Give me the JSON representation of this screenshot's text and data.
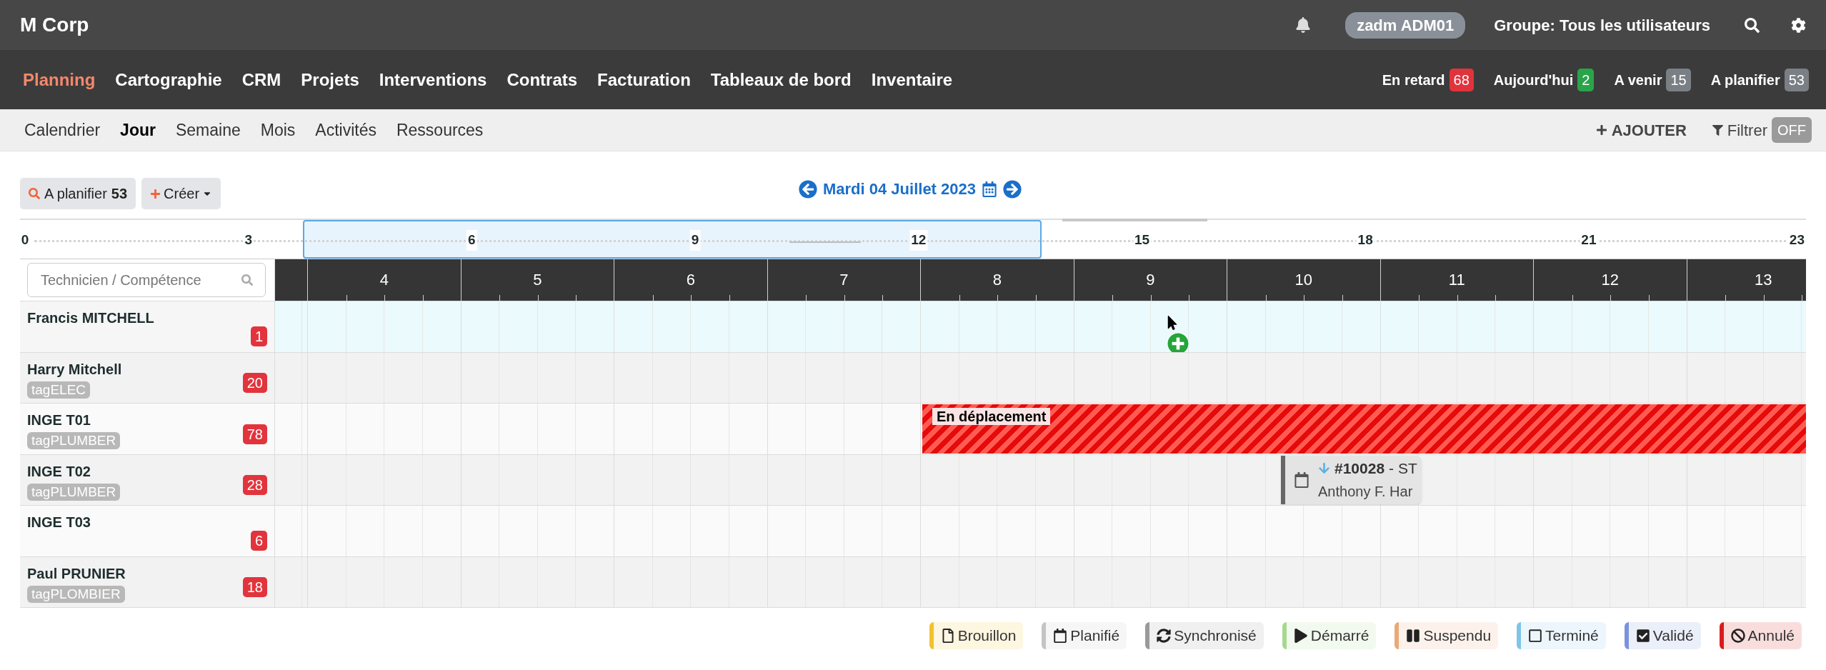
{
  "app": {
    "title": "M Corp",
    "user": "zadm ADM01",
    "group": "Groupe: Tous les utilisateurs"
  },
  "nav": [
    {
      "label": "Planning",
      "selected": true
    },
    {
      "label": "Cartographie",
      "selected": false
    },
    {
      "label": "CRM",
      "selected": false
    },
    {
      "label": "Projets",
      "selected": false
    },
    {
      "label": "Interventions",
      "selected": false
    },
    {
      "label": "Contrats",
      "selected": false
    },
    {
      "label": "Facturation",
      "selected": false
    },
    {
      "label": "Tableaux de bord",
      "selected": false
    },
    {
      "label": "Inventaire",
      "selected": false
    }
  ],
  "counters": [
    {
      "label": "En retard",
      "count": "68",
      "color": "#e0343c"
    },
    {
      "label": "Aujourd'hui",
      "count": "2",
      "color": "#2aa44a"
    },
    {
      "label": "A venir",
      "count": "15",
      "color": "#7a7f85"
    },
    {
      "label": "A planifier",
      "count": "53",
      "color": "#7a7f85"
    }
  ],
  "subnav": [
    {
      "label": "Calendrier",
      "selected": false
    },
    {
      "label": "Jour",
      "selected": true
    },
    {
      "label": "Semaine",
      "selected": false
    },
    {
      "label": "Mois",
      "selected": false
    },
    {
      "label": "Activités",
      "selected": false
    },
    {
      "label": "Ressources",
      "selected": false
    }
  ],
  "actions": {
    "add": "AJOUTER",
    "filter": "Filtrer",
    "filter_state": "OFF"
  },
  "toolbar": {
    "to_plan_label": "A planifier",
    "to_plan_count": "53",
    "create": "Créer",
    "date": "Mardi 04 Juillet 2023"
  },
  "overview_ticks": [
    "0",
    "3",
    "6",
    "9",
    "12",
    "15",
    "18",
    "21",
    "23"
  ],
  "search": {
    "placeholder": "Technicien / Compétence"
  },
  "hours": [
    "4",
    "5",
    "6",
    "7",
    "8",
    "9",
    "10",
    "11",
    "12",
    "13"
  ],
  "rows": [
    {
      "name": "Francis MITCHELL",
      "count": "1",
      "selected": true,
      "events": []
    },
    {
      "name": "Harry Mitchell",
      "tag": "tagELEC",
      "count": "20",
      "selected": false,
      "events": []
    },
    {
      "name": "INGE T01",
      "tag": "tagPLUMBER",
      "count": "78",
      "selected": false,
      "events": [
        {
          "kind": "absence",
          "label": "En déplacement"
        }
      ]
    },
    {
      "name": "INGE T02",
      "tag": "tagPLUMBER",
      "count": "28",
      "selected": false,
      "events": [
        {
          "kind": "intervention",
          "number": "#10028",
          "suffix": "- ST",
          "client": "Anthony F. Har"
        }
      ]
    },
    {
      "name": "INGE T03",
      "count": "6",
      "selected": false,
      "events": []
    },
    {
      "name": "Paul PRUNIER",
      "tag": "tagPLOMBIER",
      "count": "18",
      "selected": false,
      "events": []
    }
  ],
  "legend": [
    {
      "kind": "draft",
      "label": "Brouillon",
      "color": "#f2c12e"
    },
    {
      "kind": "planned",
      "label": "Planifié",
      "color": "#c4c4c4"
    },
    {
      "kind": "synced",
      "label": "Synchronisé",
      "color": "#9a9a9a"
    },
    {
      "kind": "started",
      "label": "Démarré",
      "color": "#a6d88f"
    },
    {
      "kind": "suspended",
      "label": "Suspendu",
      "color": "#e9a978"
    },
    {
      "kind": "done",
      "label": "Terminé",
      "color": "#7ec5e8"
    },
    {
      "kind": "validated",
      "label": "Validé",
      "color": "#7b93dd"
    },
    {
      "kind": "cancelled",
      "label": "Annulé",
      "color": "#d91c1c"
    }
  ]
}
